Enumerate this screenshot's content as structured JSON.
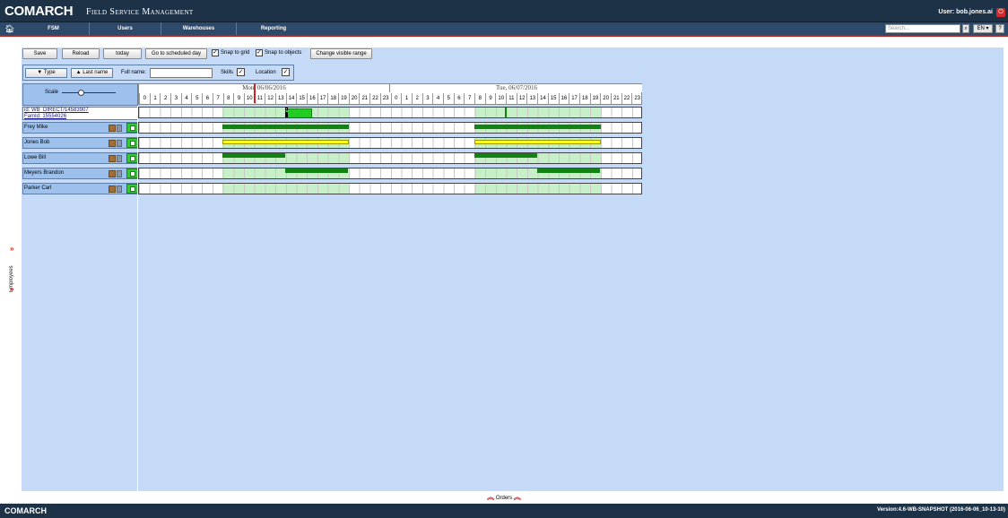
{
  "header": {
    "logo": "COMARCH",
    "app_title": "Field Service Management",
    "user": "User: bob.jones.ai",
    "logout_icon": "power-icon"
  },
  "nav": {
    "home_icon": "home-icon",
    "items": [
      "FSM",
      "Users",
      "Warehouses",
      "Reporting"
    ],
    "search_placeholder": "Search...",
    "lang": "EN",
    "help": "?"
  },
  "toolbar": {
    "save": "Save",
    "reload": "Reload",
    "today": "today",
    "go_scheduled": "Go to scheduled day",
    "snap_grid": "Snap to grid",
    "snap_objects": "Snap to objects",
    "change_range": "Change visible range",
    "snap_grid_checked": true,
    "snap_objects_checked": true
  },
  "filters": {
    "type_btn": "Type",
    "lastname_btn": "Last name",
    "fullname_label": "Full name:",
    "fullname_value": "",
    "skills_label": "Skills",
    "location_label": "Location",
    "skills_checked": true,
    "location_checked": true
  },
  "scale_label": "Scale",
  "days": [
    {
      "label": "Mon, 06/06/2016"
    },
    {
      "label": "Tue, 06/07/2016"
    }
  ],
  "hours": [
    "0",
    "1",
    "2",
    "3",
    "4",
    "5",
    "6",
    "7",
    "8",
    "9",
    "10",
    "11",
    "12",
    "13",
    "14",
    "15",
    "16",
    "17",
    "18",
    "19",
    "20",
    "21",
    "22",
    "23"
  ],
  "special_row": {
    "line1": "id: WB_DIRECT/14583907",
    "line2": "FamId: 15554026"
  },
  "employees": [
    {
      "name": "Frey Mike"
    },
    {
      "name": "Jones Bob"
    },
    {
      "name": "Lowe Bill"
    },
    {
      "name": "Meyers Brandon"
    },
    {
      "name": "Parker Carl"
    }
  ],
  "sidebar_label": "Employees",
  "orders_label": "Orders",
  "footer": {
    "logo": "COMARCH",
    "version": "Version:4.6-WB-SNAPSHOT (2016-06-06_10-13-10)"
  },
  "colors": {
    "dark_green": "#128212",
    "yellow": "#ffff00",
    "bright_green": "#22cc22",
    "now_line": "#d61f1f"
  }
}
